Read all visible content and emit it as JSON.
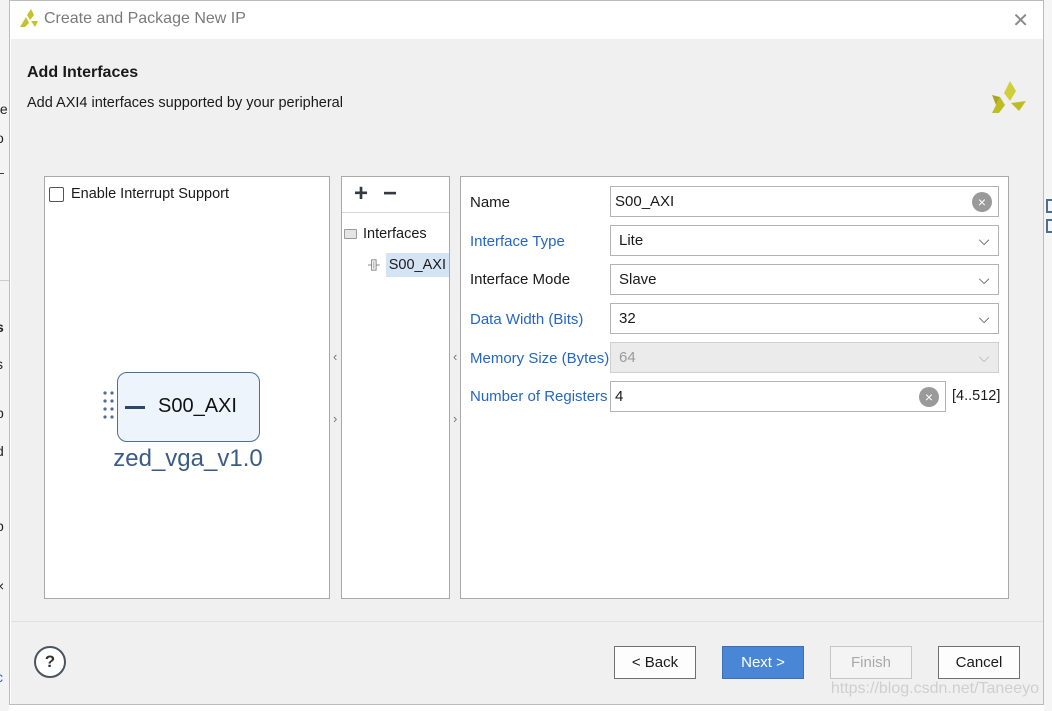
{
  "window": {
    "title": "Create and Package New IP",
    "close_icon": "close-icon"
  },
  "header": {
    "title": "Add Interfaces",
    "subtitle": "Add AXI4 interfaces supported by your peripheral"
  },
  "background_fragments": [
    "te",
    "o",
    "_",
    "s",
    "s",
    "p",
    "d",
    "p",
    "×",
    "c"
  ],
  "left_panel": {
    "checkbox_label": "Enable Interrupt Support",
    "checkbox_checked": false,
    "ip_block_port": "S00_AXI",
    "ip_name": "zed_vga_v1.0"
  },
  "mid_panel": {
    "add_label": "+",
    "remove_label": "−",
    "tree_root": "Interfaces",
    "tree_item": "S00_AXI"
  },
  "splitter_glyphs": {
    "left": "‹",
    "right": "›"
  },
  "form": {
    "name_label": "Name",
    "name_value": "S00_AXI",
    "interface_type_label": "Interface Type",
    "interface_type_value": "Lite",
    "interface_mode_label": "Interface Mode",
    "interface_mode_value": "Slave",
    "data_width_label": "Data Width (Bits)",
    "data_width_value": "32",
    "memory_size_label": "Memory Size (Bytes)",
    "memory_size_value": "64",
    "num_registers_label": "Number of Registers",
    "num_registers_value": "4",
    "num_registers_range": "[4..512]",
    "clear_glyph": "×",
    "chevron_glyph": "⌵"
  },
  "footer": {
    "help_label": "?",
    "back_label": "< Back",
    "next_label": "Next >",
    "finish_label": "Finish",
    "cancel_label": "Cancel",
    "watermark": "https://blog.csdn.net/Taneeyo"
  },
  "colors": {
    "accent_blue": "#4a86d6",
    "link_blue": "#2366c7",
    "xilinx_logo": "#c4c42a"
  }
}
